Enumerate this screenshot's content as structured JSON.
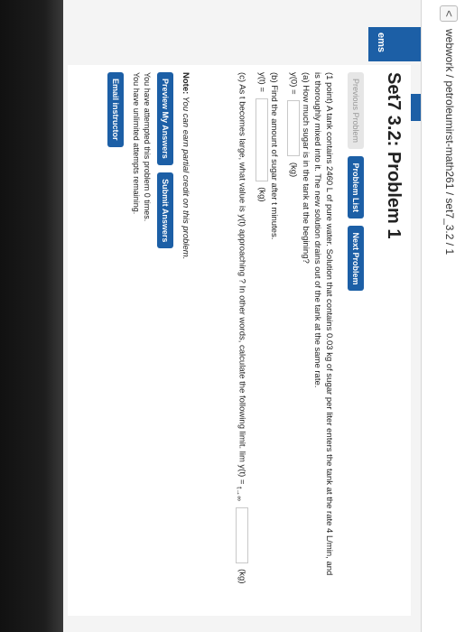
{
  "topbar": {
    "back_icon": "chevron-left-icon",
    "back_glyph": "<",
    "breadcrumb": "webwork / petroleumirst-math261 / set7_3.2 / 1"
  },
  "sidebar": {
    "label": "ems"
  },
  "page": {
    "title": "Set7 3.2: Problem 1"
  },
  "nav": {
    "previous": "Previous Problem",
    "list": "Problem List",
    "next": "Next Problem"
  },
  "problem": {
    "intro_1": "(1 point) A tank contains 2460 L of pure water. Solution that contains 0.03 kg of sugar per liter enters the tank at the rate 4 L/min, and",
    "intro_2": "is thoroughly mixed into it. The new solution drains out of the tank at the same rate.",
    "part_a": "(a) How much sugar is in the tank at the begining?",
    "part_a_lhs": "y(0) =",
    "part_a_unit": "(kg)",
    "part_b": "(b) Find the amount of sugar after t minutes.",
    "part_b_lhs": "y(t) =",
    "part_b_unit": "(kg)",
    "part_c": "(c) As t becomes large, what value is y(t) approaching ? In other words, calculate the following limit.",
    "part_c_lim": "lim y(t) =",
    "part_c_sub": "t→∞",
    "part_c_unit": "(kg)"
  },
  "note": {
    "label": "Note:",
    "text": " You can earn partial credit on this problem."
  },
  "actions": {
    "preview": "Preview My Answers",
    "submit": "Submit Answers"
  },
  "attempts": {
    "line1": "You have attempted this problem 0 times.",
    "line2": "You have unlimited attempts remaining."
  },
  "email": {
    "label": "Email instructor"
  },
  "colors": {
    "accent": "#1c5fa6"
  }
}
